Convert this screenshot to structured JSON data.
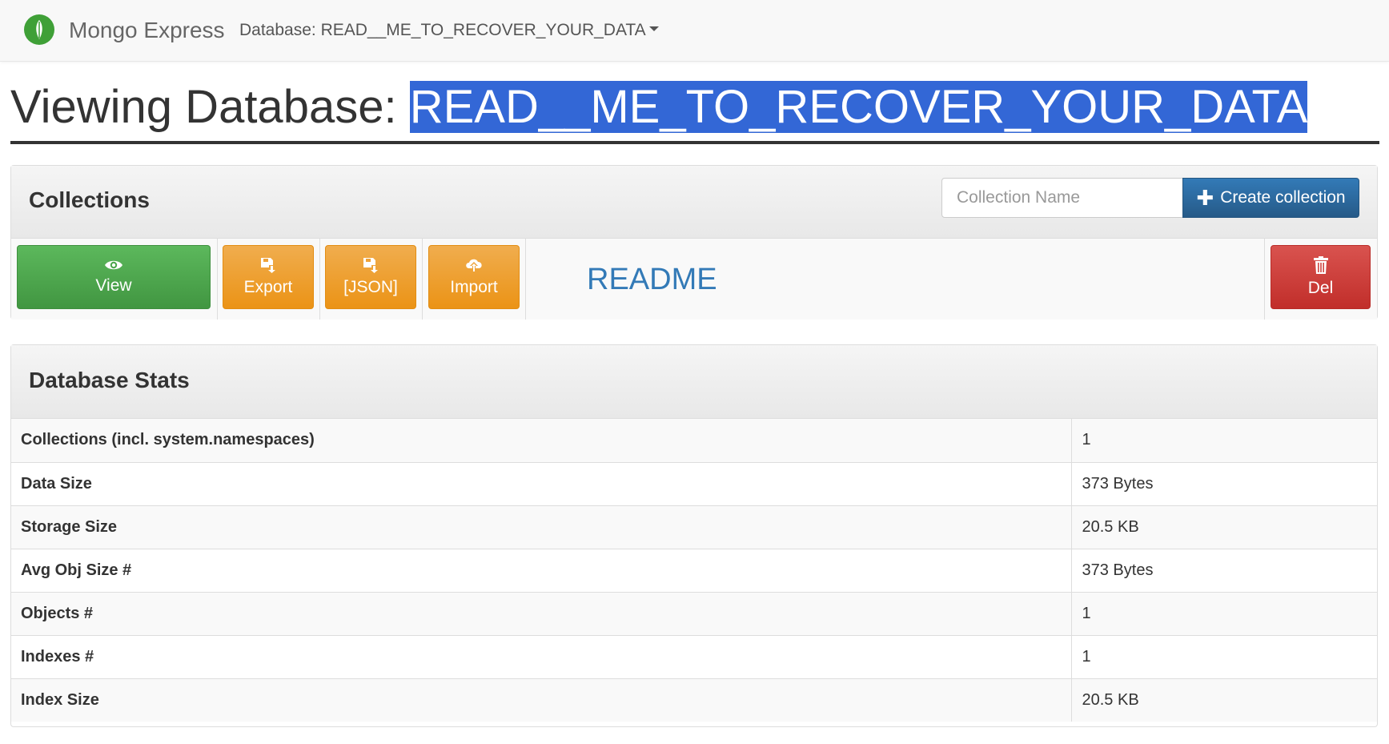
{
  "navbar": {
    "brand": "Mongo Express",
    "database_dropdown": "Database: READ__ME_TO_RECOVER_YOUR_DATA"
  },
  "title": {
    "prefix": "Viewing Database: ",
    "db_name": "READ__ME_TO_RECOVER_YOUR_DATA"
  },
  "collections": {
    "heading": "Collections",
    "input_placeholder": "Collection Name",
    "create_label": "Create collection",
    "row": {
      "view_label": "View",
      "export_label": "Export",
      "json_label": "[JSON]",
      "import_label": "Import",
      "name": "README",
      "delete_label": "Del"
    }
  },
  "stats": {
    "heading": "Database Stats",
    "rows": [
      {
        "label": "Collections (incl. system.namespaces)",
        "value": "1"
      },
      {
        "label": "Data Size",
        "value": "373 Bytes"
      },
      {
        "label": "Storage Size",
        "value": "20.5 KB"
      },
      {
        "label": "Avg Obj Size #",
        "value": "373 Bytes"
      },
      {
        "label": "Objects #",
        "value": "1"
      },
      {
        "label": "Indexes #",
        "value": "1"
      },
      {
        "label": "Index Size",
        "value": "20.5 KB"
      }
    ]
  },
  "colors": {
    "success": "#5cb85c",
    "warning": "#f0ad4e",
    "danger": "#d9534f",
    "primary": "#337ab7",
    "selection": "#3367d6",
    "logo": "#3fa037"
  },
  "icons": {
    "logo": "mongodb-leaf-icon",
    "view": "eye-icon",
    "export": "save-download-icon",
    "json": "save-download-icon",
    "import": "cloud-upload-icon",
    "delete": "trash-icon",
    "create": "plus-icon"
  }
}
